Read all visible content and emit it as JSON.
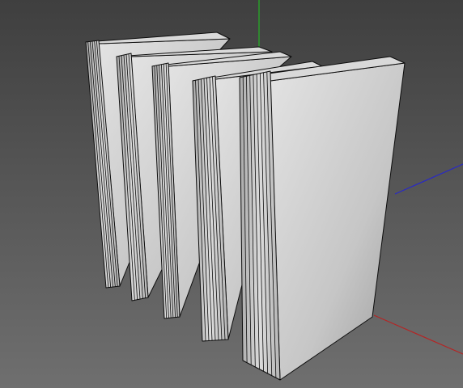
{
  "viewport": {
    "background_gradient": [
      "#3f3f3f",
      "#6f6f6f"
    ],
    "axis_colors": {
      "x": "#b52424",
      "y": "#23b523",
      "z": "#2828c8"
    }
  },
  "scene": {
    "object_count": 5,
    "face_colors": {
      "cover_light": "#d9d9d9",
      "cover_mid": "#bfbfbf",
      "cover_dark": "#8e8e8e",
      "spine": "#c8c8c8",
      "edge": "#0d0d0d"
    }
  }
}
